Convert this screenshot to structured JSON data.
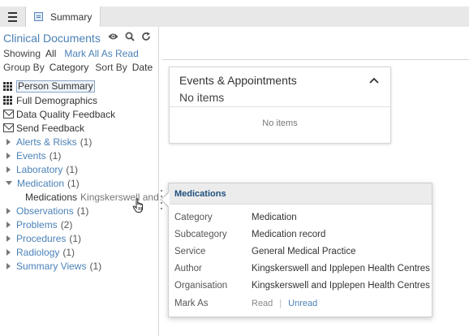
{
  "tab": {
    "label": "Summary",
    "icon": "document-icon"
  },
  "panel": {
    "title": "Clinical Documents",
    "icons": [
      "eye-icon",
      "search-icon",
      "refresh-icon"
    ],
    "showing_label": "Showing",
    "showing_value": "All",
    "mark_all_read": "Mark All As Read",
    "group_by_label": "Group By",
    "group_by_value": "Category",
    "sort_by_label": "Sort By",
    "sort_by_value": "Date"
  },
  "tree": {
    "top_items": [
      {
        "label": "Person Summary",
        "icon": "grid-icon",
        "selected": true
      },
      {
        "label": "Full Demographics",
        "icon": "grid-icon"
      },
      {
        "label": "Data Quality Feedback",
        "icon": "mail-icon"
      },
      {
        "label": "Send Feedback",
        "icon": "mail-icon"
      }
    ],
    "categories": [
      {
        "label": "Alerts & Risks",
        "count": "(1)"
      },
      {
        "label": "Events",
        "count": "(1)"
      },
      {
        "label": "Laboratory",
        "count": "(1)"
      },
      {
        "label": "Medication",
        "count": "(1)"
      },
      {
        "label": "Observations",
        "count": "(1)"
      },
      {
        "label": "Problems",
        "count": "(2)"
      },
      {
        "label": "Procedures",
        "count": "(1)"
      },
      {
        "label": "Radiology",
        "count": "(1)"
      },
      {
        "label": "Summary Views",
        "count": "(1)"
      }
    ],
    "medication_child": {
      "title": "Medications",
      "desc": "Kingskerswell and Ipplepen Health Centres"
    }
  },
  "events_card": {
    "title": "Events & Appointments",
    "subtitle": "No items",
    "empty_text": "No items"
  },
  "popup": {
    "title": "Medications",
    "rows": [
      {
        "key": "Category",
        "value": "Medication"
      },
      {
        "key": "Subcategory",
        "value": "Medication record"
      },
      {
        "key": "Service",
        "value": "General Medical Practice"
      },
      {
        "key": "Author",
        "value": "Kingskerswell and Ipplepen Health Centres"
      },
      {
        "key": "Organisation",
        "value": "Kingskerswell and Ipplepen Health Centres"
      }
    ],
    "mark_as_label": "Mark As",
    "read_label": "Read",
    "separator": "|",
    "unread_label": "Unread"
  },
  "colors": {
    "accent": "#4b82b8",
    "popup_title": "#1f4f7e"
  }
}
